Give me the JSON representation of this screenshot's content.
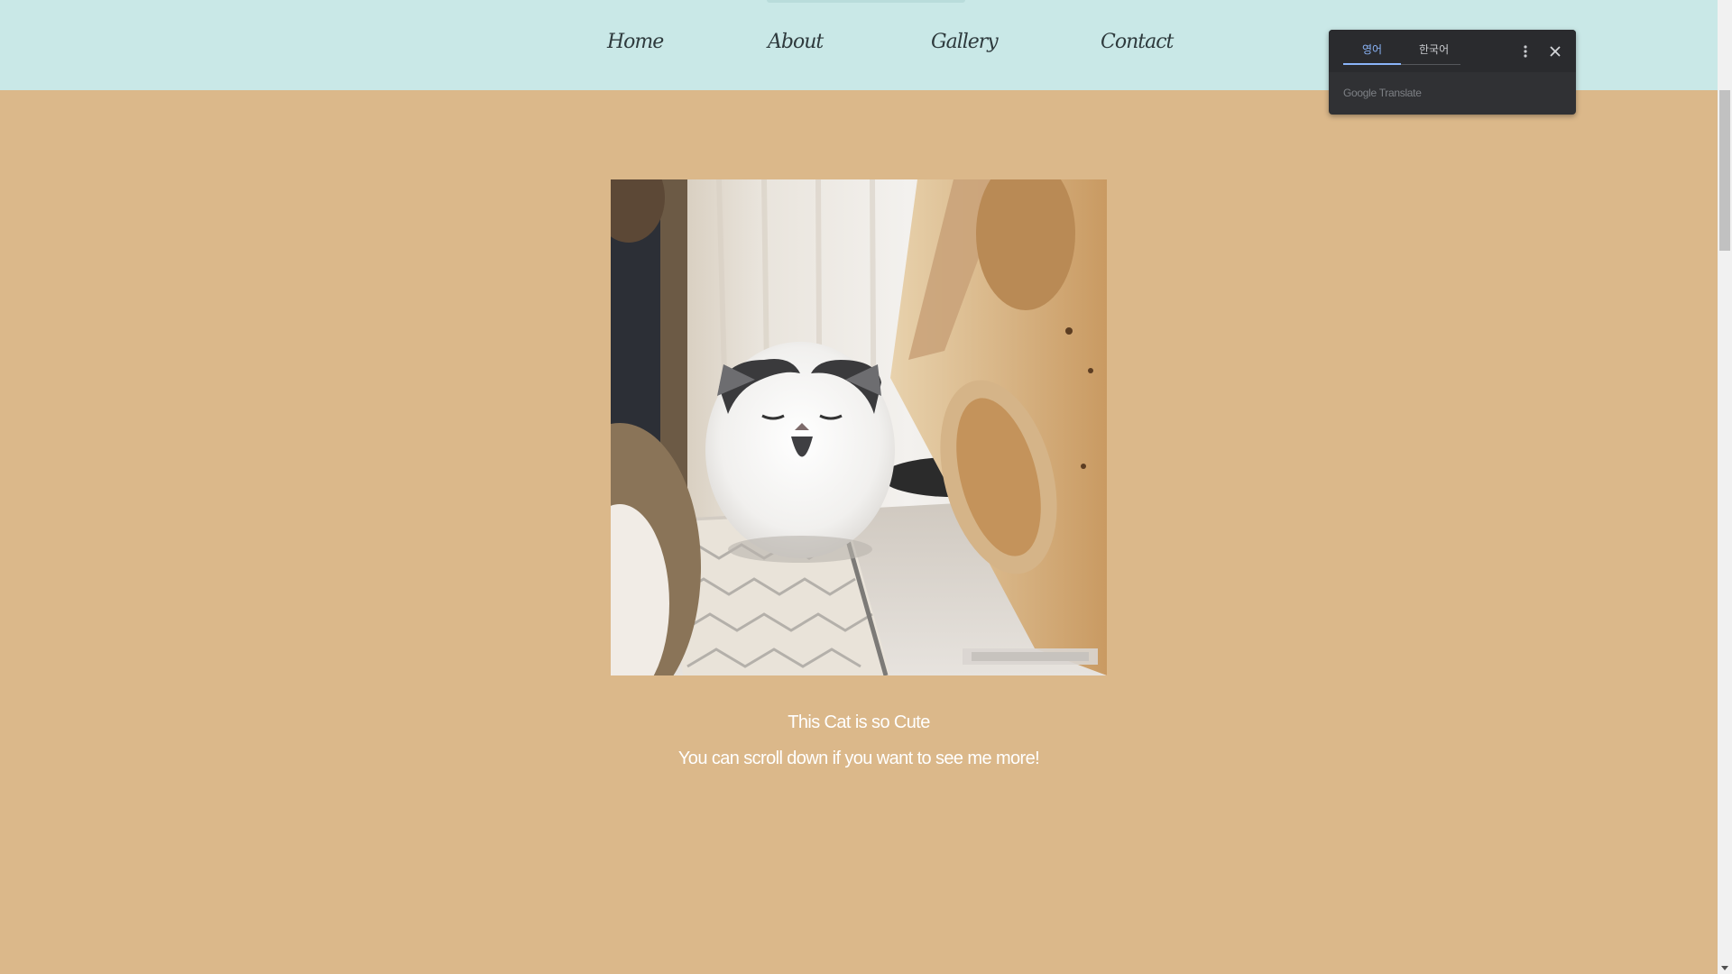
{
  "nav": {
    "items": [
      {
        "label": "Home"
      },
      {
        "label": "About"
      },
      {
        "label": "Gallery"
      },
      {
        "label": "Contact"
      }
    ]
  },
  "hero": {
    "image_icon": "cat-photo",
    "caption_line1": "This Cat is so Cute",
    "caption_line2": "You can scroll down if you want to see me more!"
  },
  "translate_popup": {
    "tabs": [
      {
        "label": "영어",
        "active": true
      },
      {
        "label": "한국어",
        "active": false
      }
    ],
    "brand": "Google Translate",
    "menu_icon": "more-vert-icon",
    "close_icon": "close-icon"
  },
  "colors": {
    "page_background": "#dbb88a",
    "nav_background": "#c9e8e7",
    "caption_text": "#ffffff",
    "popup_background": "#303134",
    "popup_active_tab": "#8ab4f8"
  }
}
